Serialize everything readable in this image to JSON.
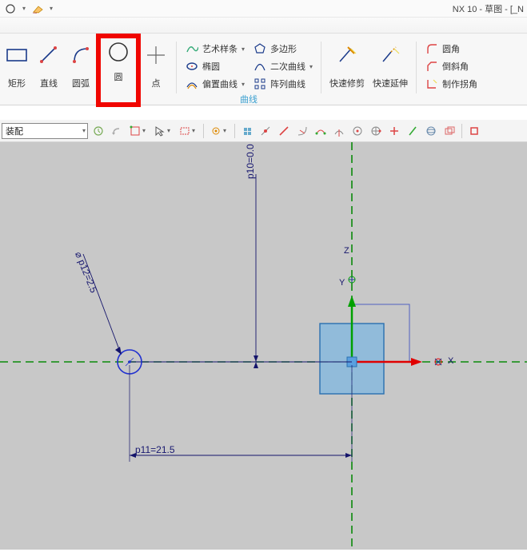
{
  "title": "NX 10 - 草图 - [_N",
  "ribbon": {
    "rectangle": "矩形",
    "line": "直线",
    "arc": "圆弧",
    "circle": "圆",
    "point": "点",
    "art_spline": "艺术样条",
    "ellipse": "椭圆",
    "offset_curve": "偏置曲线",
    "polygon": "多边形",
    "conic": "二次曲线",
    "pattern_curve": "阵列曲线",
    "quick_trim": "快速修剪",
    "quick_extend": "快速延伸",
    "fillet": "圆角",
    "chamfer": "倒斜角",
    "make_corner": "制作拐角",
    "group_label": "曲线"
  },
  "toolbar2": {
    "combo_label": "装配"
  },
  "sketch": {
    "p10": "p10=0.0",
    "p11": "p11=21.5",
    "p12": "p12=2.5",
    "axis_z": "Z",
    "axis_y": "Y",
    "axis_x": "X"
  }
}
